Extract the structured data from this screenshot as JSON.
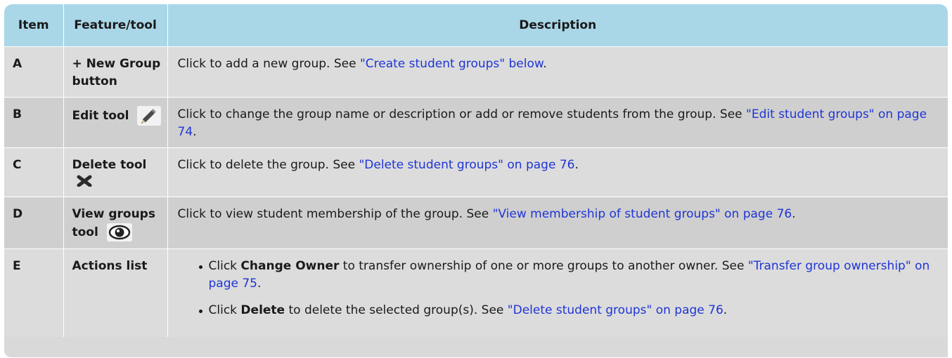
{
  "headers": {
    "item": "Item",
    "feature": "Feature/tool",
    "description": "Description"
  },
  "rows": [
    {
      "item": "A",
      "feature": "+ New Group button",
      "desc_text": "Click to add a new group. See ",
      "desc_link": "\"Create student groups\" below",
      "desc_after": "."
    },
    {
      "item": "B",
      "feature": "Edit tool",
      "icon": "pencil-icon",
      "desc_text": "Click to change the group name or description or add or remove students from the group. See ",
      "desc_link": "\"Edit student groups\" on page 74",
      "desc_after": "."
    },
    {
      "item": "C",
      "feature": "Delete tool",
      "icon": "delete-x-icon",
      "desc_text": "Click to delete the group. See ",
      "desc_link": "\"Delete student groups\" on page 76",
      "desc_after": "."
    },
    {
      "item": "D",
      "feature": "View groups tool",
      "icon": "eye-icon",
      "desc_text": "Click to view student membership of the group. See ",
      "desc_link": "\"View membership of student groups\" on page 76",
      "desc_after": "."
    },
    {
      "item": "E",
      "feature": "Actions list",
      "bullets": [
        {
          "pre": "Click ",
          "bold": "Change Owner",
          "mid": " to transfer ownership of one or more groups to another owner. See ",
          "link": "\"Transfer group ownership\" on page 75",
          "post": "."
        },
        {
          "pre": "Click ",
          "bold": "Delete",
          "mid": " to delete the selected group(s). See ",
          "link": "\"Delete student groups\" on page 76",
          "post": "."
        }
      ]
    }
  ],
  "colors": {
    "header_bg": "#a9d7e8",
    "row_light": "#dcdcdc",
    "row_dark": "#cfcfcf",
    "link": "#1f35d6"
  }
}
